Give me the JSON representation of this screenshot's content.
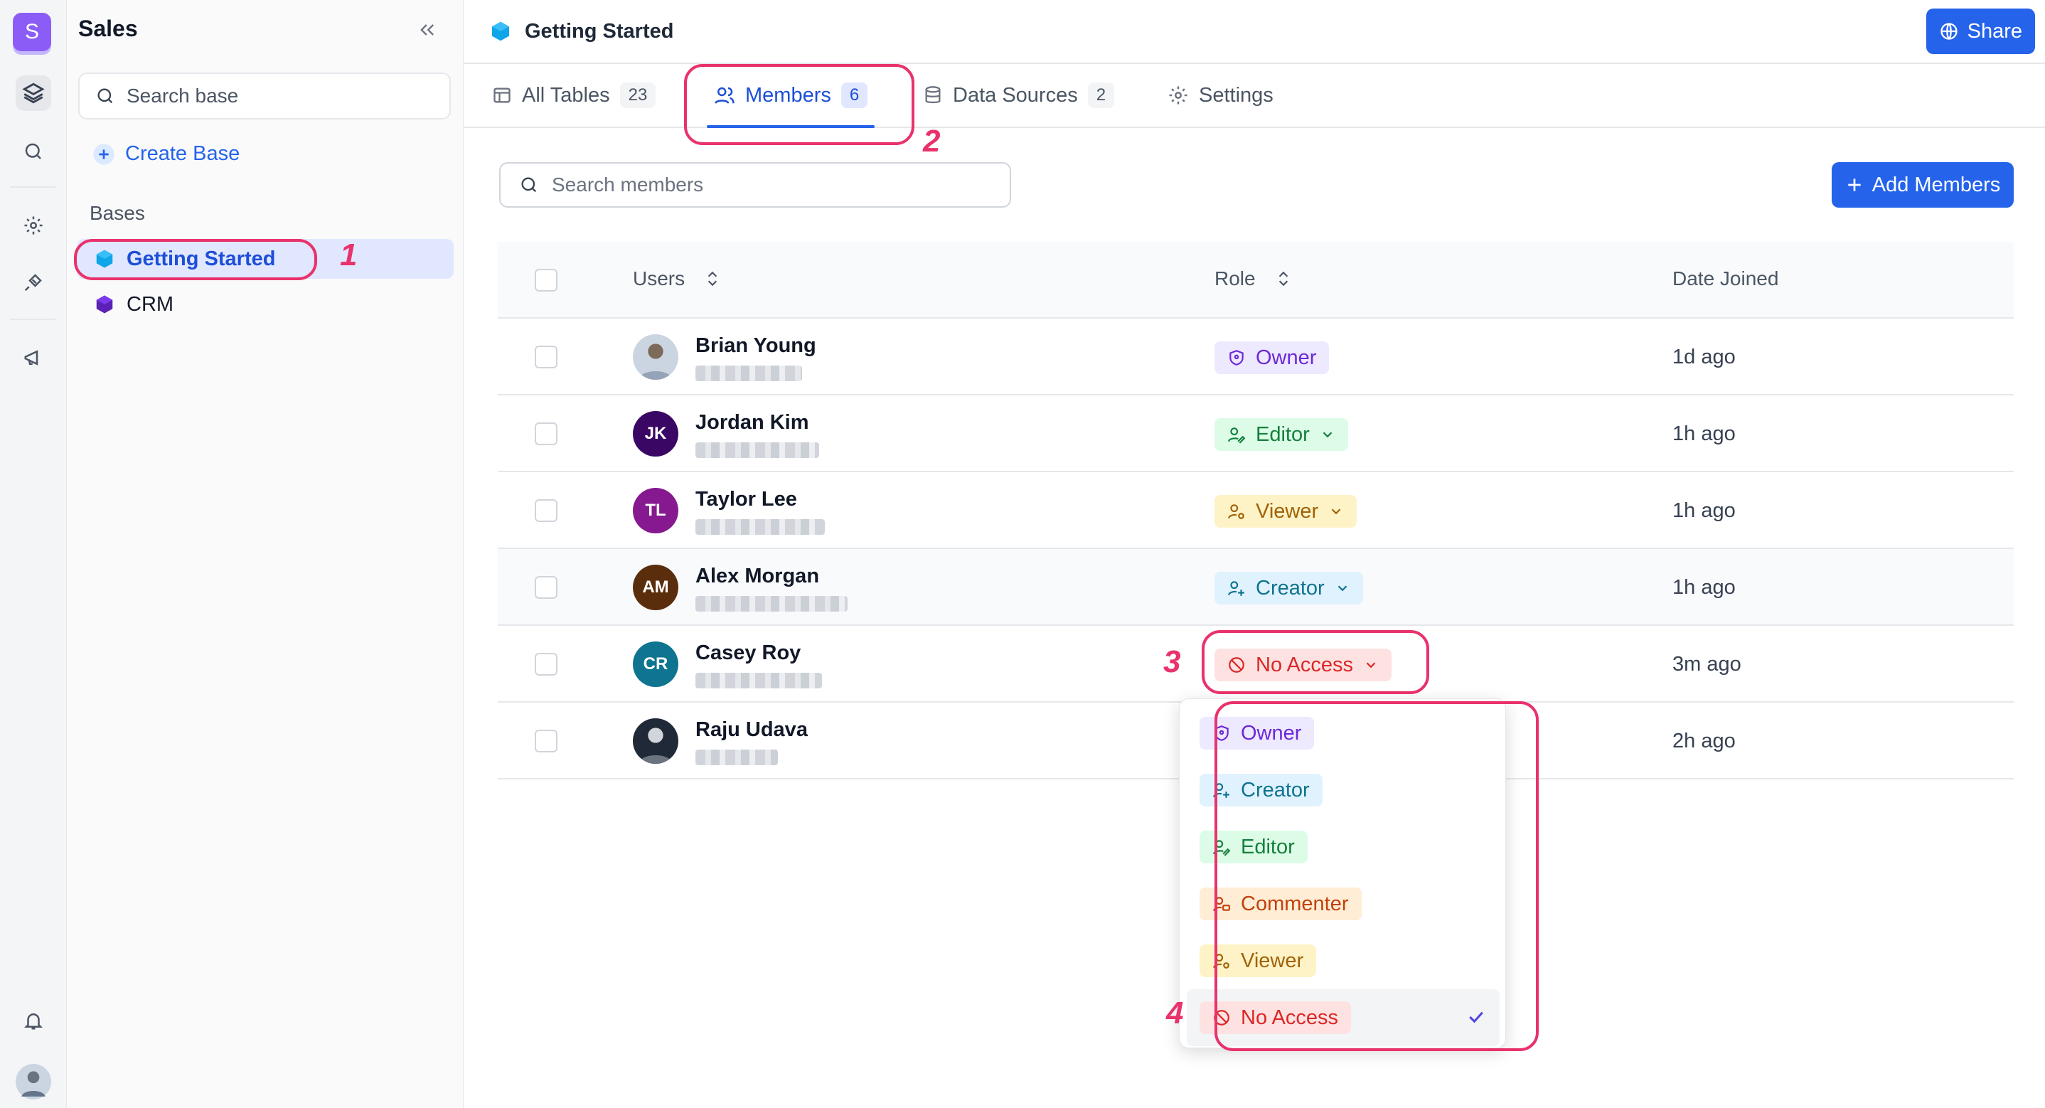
{
  "rail": {
    "workspace_initial": "S"
  },
  "sidebar": {
    "title": "Sales",
    "search_placeholder": "Search base",
    "create_label": "Create Base",
    "bases_label": "Bases",
    "bases": [
      {
        "label": "Getting Started",
        "color": "#0ea5e9"
      },
      {
        "label": "CRM",
        "color": "#6d28d9"
      }
    ]
  },
  "header": {
    "title": "Getting Started",
    "share_label": "Share"
  },
  "tabs": [
    {
      "label": "All Tables",
      "count": "23"
    },
    {
      "label": "Members",
      "count": "6"
    },
    {
      "label": "Data Sources",
      "count": "2"
    },
    {
      "label": "Settings"
    }
  ],
  "members": {
    "search_placeholder": "Search members",
    "add_label": "Add Members",
    "columns": {
      "users": "Users",
      "role": "Role",
      "date": "Date Joined"
    },
    "rows": [
      {
        "name": "Brian Young",
        "initials": "",
        "role": "Owner",
        "joined": "1d ago",
        "avatar_color": "#9ca3af"
      },
      {
        "name": "Jordan Kim",
        "initials": "JK",
        "role": "Editor",
        "joined": "1h ago",
        "avatar_color": "#3b0764"
      },
      {
        "name": "Taylor Lee",
        "initials": "TL",
        "role": "Viewer",
        "joined": "1h ago",
        "avatar_color": "#86198f"
      },
      {
        "name": "Alex Morgan",
        "initials": "AM",
        "role": "Creator",
        "joined": "1h ago",
        "avatar_color": "#5a2d0c"
      },
      {
        "name": "Casey Roy",
        "initials": "CR",
        "role": "No Access",
        "joined": "3m ago",
        "avatar_color": "#0e7490"
      },
      {
        "name": "Raju Udava",
        "initials": "",
        "role": "",
        "joined": "2h ago",
        "avatar_color": "#111827"
      }
    ]
  },
  "role_menu": {
    "options": [
      "Owner",
      "Creator",
      "Editor",
      "Commenter",
      "Viewer",
      "No Access"
    ],
    "selected": "No Access"
  },
  "annotations": [
    "1",
    "2",
    "3",
    "4"
  ]
}
